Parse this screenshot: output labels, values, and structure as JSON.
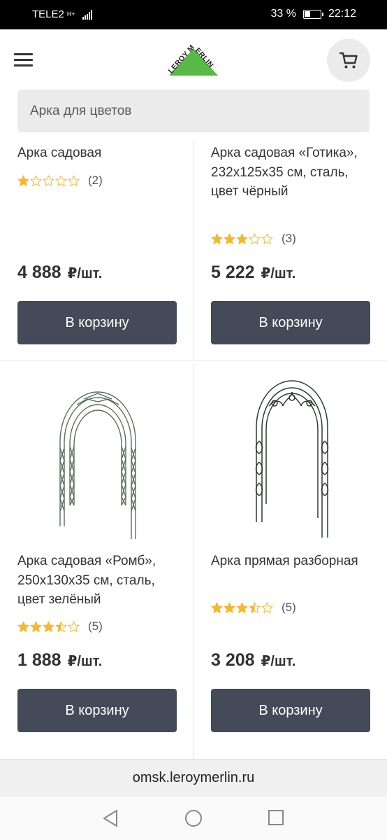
{
  "status_bar": {
    "carrier": "TELE2",
    "network": "H+",
    "battery": "33 %",
    "time": "22:12"
  },
  "header": {
    "logo_text": "LEROY MERLIN",
    "menu_icon": "hamburger-menu-icon",
    "cart_icon": "cart-icon"
  },
  "search": {
    "placeholder": "Арка для цветов"
  },
  "products": [
    {
      "title": "Арка садовая",
      "rating": 1,
      "review_count": "(2)",
      "price": "4 888",
      "unit": "₽/шт.",
      "button": "В корзину"
    },
    {
      "title": "Арка садовая «Готика», 232x125x35 см, сталь, цвет чёрный",
      "rating": 3,
      "review_count": "(3)",
      "price": "5 222",
      "unit": "₽/шт.",
      "button": "В корзину"
    },
    {
      "title": "Арка садовая «Ромб», 250x130x35 см, сталь, цвет зелёный",
      "rating": 3.5,
      "review_count": "(5)",
      "price": "1 888",
      "unit": "₽/шт.",
      "button": "В корзину"
    },
    {
      "title": "Арка прямая разборная",
      "rating": 3.5,
      "review_count": "(5)",
      "price": "3 208",
      "unit": "₽/шт.",
      "button": "В корзину"
    }
  ],
  "colors": {
    "star": "#f5b82e",
    "button": "#444a58",
    "logo_green": "#58b947"
  },
  "url_bar": {
    "url": "omsk.leroymerlin.ru"
  }
}
